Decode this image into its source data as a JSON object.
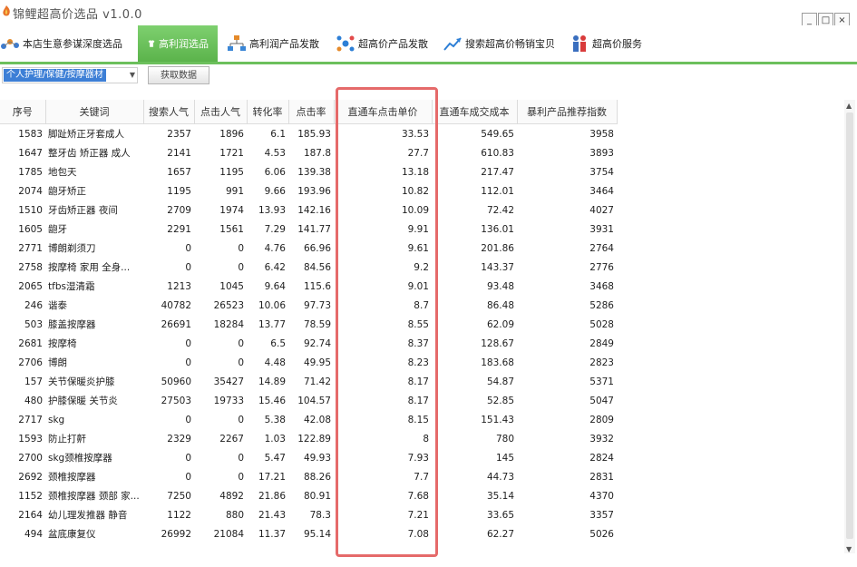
{
  "app": {
    "title": "锦鲤超高价选品 v1.0.0",
    "minimize": "_",
    "maximize": "□",
    "close": "×"
  },
  "nav": [
    {
      "label": "本店生意参谋深度选品",
      "icon": "network-icon"
    },
    {
      "label": "高利润选品",
      "icon": "shirt-icon",
      "active": true
    },
    {
      "label": "高利润产品发散",
      "icon": "tree-icon"
    },
    {
      "label": "超高价产品发散",
      "icon": "molecule-icon"
    },
    {
      "label": "搜索超高价畅销宝贝",
      "icon": "trend-icon"
    },
    {
      "label": "超高价服务",
      "icon": "people-icon"
    }
  ],
  "toolbar": {
    "category": "个人护理/保健/按摩器材",
    "fetch_label": "获取数据"
  },
  "table": {
    "headers": [
      "序号",
      "关键词",
      "搜索人气",
      "点击人气",
      "转化率",
      "点击率",
      "直通车点击单价",
      "直通车成交成本",
      "暴利产品推荐指数"
    ],
    "rows": [
      [
        "1583",
        "脚趾矫正牙套成人",
        "2357",
        "1896",
        "6.1",
        "185.93",
        "33.53",
        "549.65",
        "3958"
      ],
      [
        "1647",
        "整牙齿 矫正器 成人",
        "2141",
        "1721",
        "4.53",
        "187.8",
        "27.7",
        "610.83",
        "3893"
      ],
      [
        "1785",
        "地包天",
        "1657",
        "1195",
        "6.06",
        "139.38",
        "13.18",
        "217.47",
        "3754"
      ],
      [
        "2074",
        "龅牙矫正",
        "1195",
        "991",
        "9.66",
        "193.96",
        "10.82",
        "112.01",
        "3464"
      ],
      [
        "1510",
        "牙齿矫正器 夜间",
        "2709",
        "1974",
        "13.93",
        "142.16",
        "10.09",
        "72.42",
        "4027"
      ],
      [
        "1605",
        "龅牙",
        "2291",
        "1561",
        "7.29",
        "141.77",
        "9.91",
        "136.01",
        "3931"
      ],
      [
        "2771",
        "博朗剃须刀",
        "0",
        "0",
        "4.76",
        "66.96",
        "9.61",
        "201.86",
        "2764"
      ],
      [
        "2758",
        "按摩椅 家用 全身...",
        "0",
        "0",
        "6.42",
        "84.56",
        "9.2",
        "143.37",
        "2776"
      ],
      [
        "2065",
        "tfbs湿清霜",
        "1213",
        "1045",
        "9.64",
        "115.6",
        "9.01",
        "93.48",
        "3468"
      ],
      [
        "246",
        "谐泰",
        "40782",
        "26523",
        "10.06",
        "97.73",
        "8.7",
        "86.48",
        "5286"
      ],
      [
        "503",
        "膝盖按摩器",
        "26691",
        "18284",
        "13.77",
        "78.59",
        "8.55",
        "62.09",
        "5028"
      ],
      [
        "2681",
        "按摩椅",
        "0",
        "0",
        "6.5",
        "92.74",
        "8.37",
        "128.67",
        "2849"
      ],
      [
        "2706",
        "博朗",
        "0",
        "0",
        "4.48",
        "49.95",
        "8.23",
        "183.68",
        "2823"
      ],
      [
        "157",
        "关节保暖炎护膝",
        "50960",
        "35427",
        "14.89",
        "71.42",
        "8.17",
        "54.87",
        "5371"
      ],
      [
        "480",
        "护膝保暖 关节炎",
        "27503",
        "19733",
        "15.46",
        "104.57",
        "8.17",
        "52.85",
        "5047"
      ],
      [
        "2717",
        "skg",
        "0",
        "0",
        "5.38",
        "42.08",
        "8.15",
        "151.43",
        "2809"
      ],
      [
        "1593",
        "防止打鼾",
        "2329",
        "2267",
        "1.03",
        "122.89",
        "8",
        "780",
        "3932"
      ],
      [
        "2700",
        "skg颈椎按摩器",
        "0",
        "0",
        "5.47",
        "49.93",
        "7.93",
        "145",
        "2824"
      ],
      [
        "2692",
        "颈椎按摩器",
        "0",
        "0",
        "17.21",
        "88.26",
        "7.7",
        "44.73",
        "2831"
      ],
      [
        "1152",
        "颈椎按摩器 颈部 家...",
        "7250",
        "4892",
        "21.86",
        "80.91",
        "7.68",
        "35.14",
        "4370"
      ],
      [
        "2164",
        "幼儿理发推器 静音",
        "1122",
        "880",
        "21.43",
        "78.3",
        "7.21",
        "33.65",
        "3357"
      ],
      [
        "494",
        "盆底康复仪",
        "26992",
        "21084",
        "11.37",
        "95.14",
        "7.08",
        "62.27",
        "5026"
      ]
    ]
  }
}
